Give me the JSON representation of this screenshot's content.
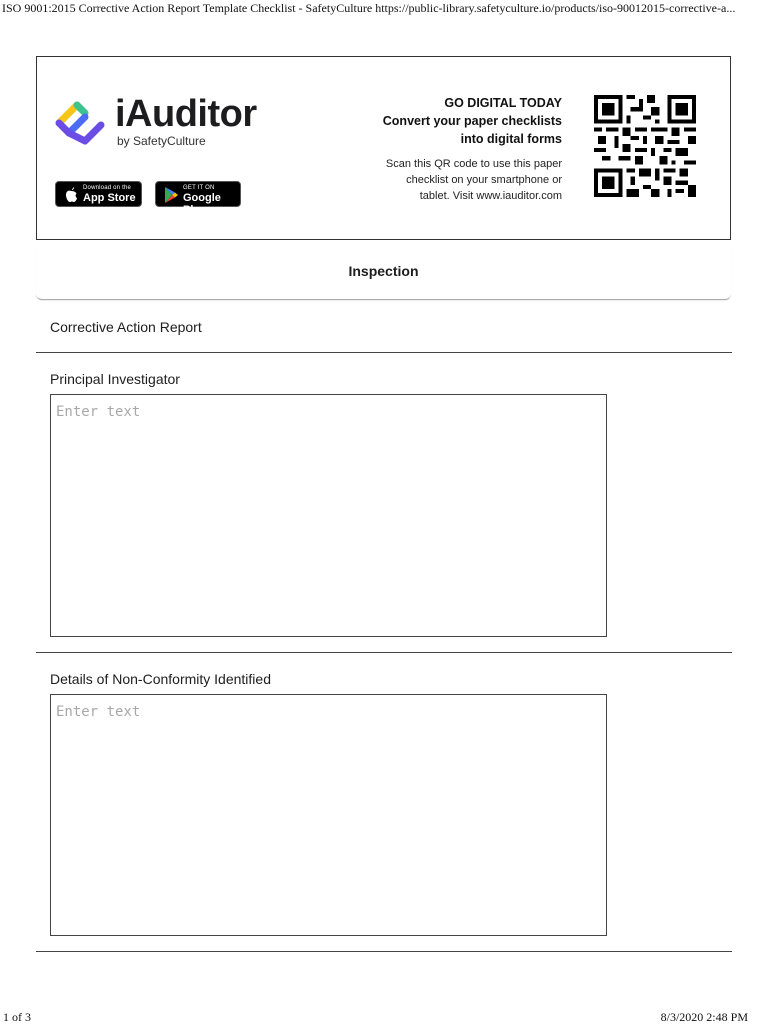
{
  "print_header": "ISO 9001:2015 Corrective Action Report Template Checklist - SafetyCulture https://public-library.safetyculture.io/products/iso-90012015-corrective-a...",
  "banner": {
    "brand": "iAuditor",
    "brand_sub": "by SafetyCulture",
    "app_store": {
      "small": "Download on the",
      "big": "App Store"
    },
    "google_play": {
      "small": "GET IT ON",
      "big": "Google Play"
    },
    "promo_heading": "GO DIGITAL TODAY",
    "promo_line1": "Convert your paper checklists",
    "promo_line2": "into digital forms",
    "scan_line1": "Scan this QR code to use this paper",
    "scan_line2": "checklist on your smartphone or",
    "scan_line3": "tablet. Visit www.iauditor.com"
  },
  "inspection_title": "Inspection",
  "section_title": "Corrective Action Report",
  "fields": [
    {
      "label": "Principal Investigator",
      "placeholder": "Enter text"
    },
    {
      "label": "Details of Non-Conformity Identified",
      "placeholder": "Enter text"
    }
  ],
  "footer": {
    "page": "1 of 3",
    "datetime": "8/3/2020 2:48 PM"
  },
  "colors": {
    "logo_yellow": "#f5c518",
    "logo_green": "#3ec28f",
    "logo_blue": "#4a6cf7",
    "logo_purple": "#6b4de6"
  }
}
